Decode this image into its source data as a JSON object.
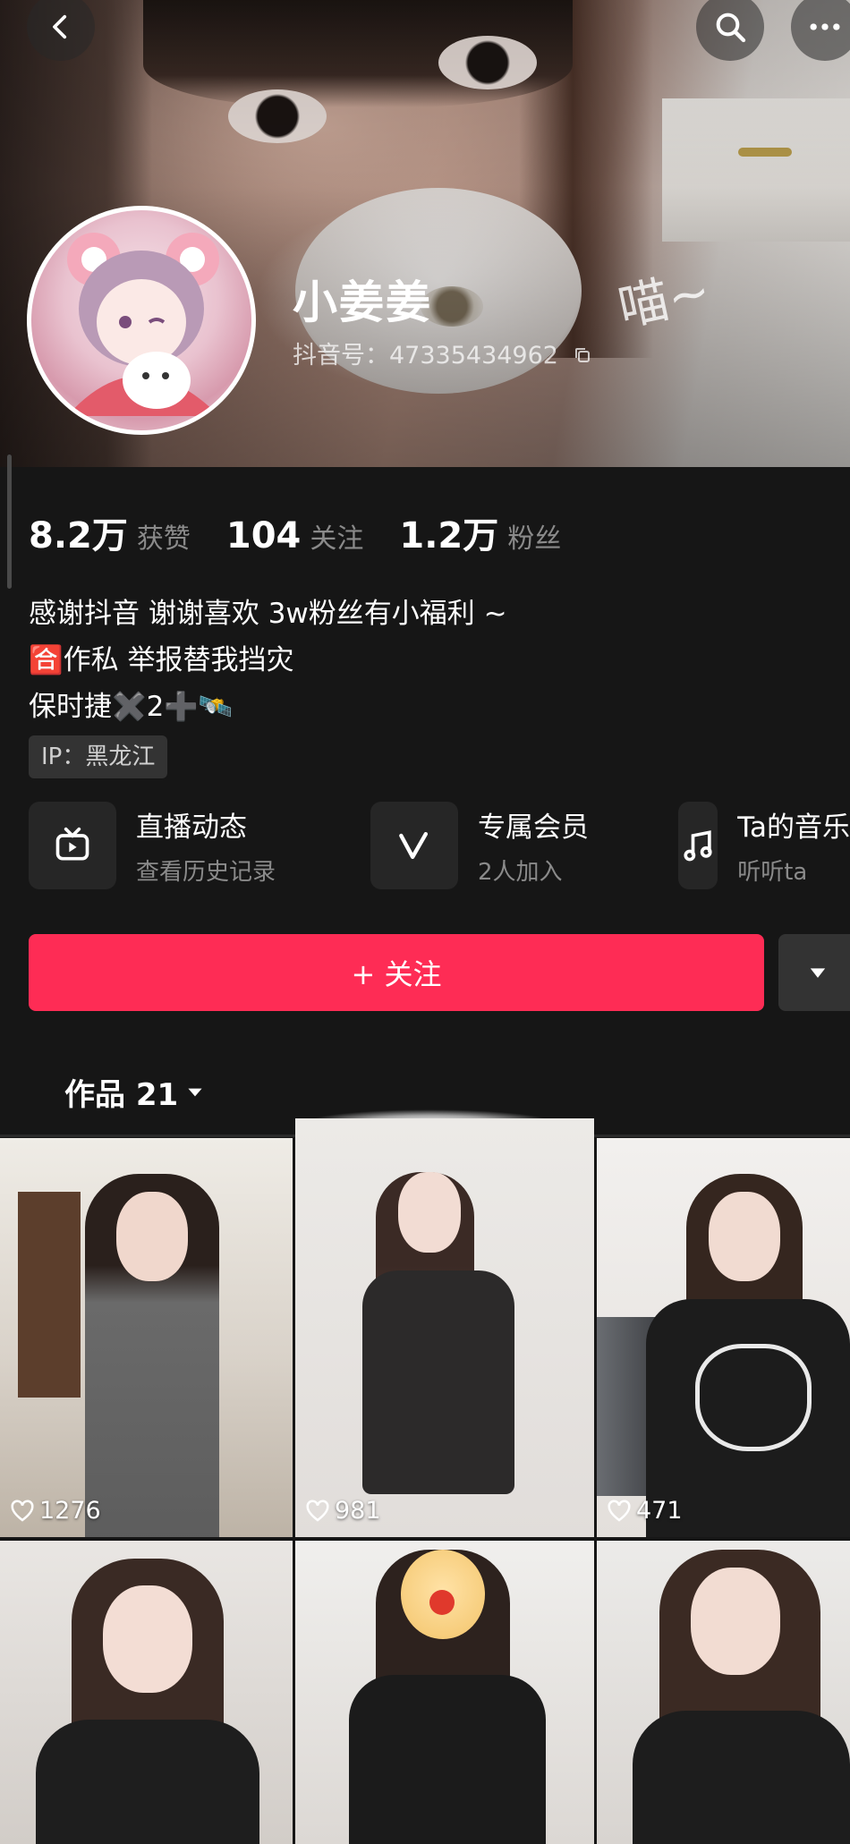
{
  "profile": {
    "name": "小姜姜",
    "douyin_id": "抖音号：47335434962",
    "watermark_text": "喵~"
  },
  "stats": [
    {
      "value": "8.2万",
      "label": "获赞"
    },
    {
      "value": "104",
      "label": "关注"
    },
    {
      "value": "1.2万",
      "label": "粉丝"
    }
  ],
  "bio": [
    "感谢抖音 谢谢喜欢 3w粉丝有小福利 ~",
    "🈴作私 举报替我挡灾",
    "保时捷✖️2➕🛰️"
  ],
  "ip_label": "IP：黑龙江",
  "services": [
    {
      "title": "直播动态",
      "subtitle": "查看历史记录",
      "icon": "tv-icon"
    },
    {
      "title": "专属会员",
      "subtitle": "2人加入",
      "icon": "v-member-icon"
    },
    {
      "title": "Ta的音乐",
      "subtitle": "听听ta",
      "icon": "music-note-icon"
    }
  ],
  "follow_label": "+ 关注",
  "works_tab": "作品 21",
  "videos": [
    {
      "likes": "1276"
    },
    {
      "likes": "981"
    },
    {
      "likes": "471"
    },
    {
      "likes": ""
    },
    {
      "likes": ""
    },
    {
      "likes": ""
    }
  ],
  "colors": {
    "accent": "#fe2c55",
    "background": "#161616",
    "muted_text": "#8a8a8a"
  }
}
